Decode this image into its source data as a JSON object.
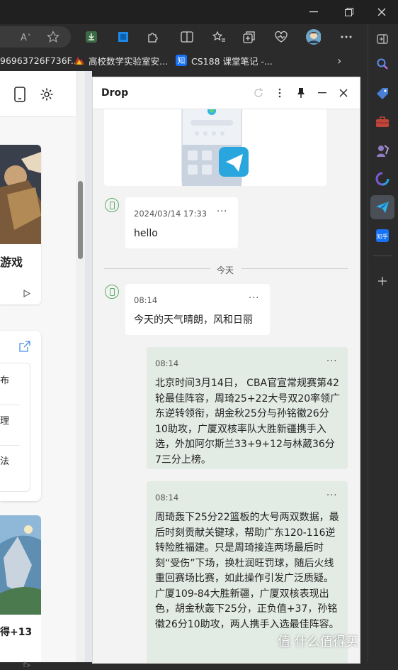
{
  "browser": {
    "favorites": [
      "96963726F736F...",
      "高校数学实验室安...",
      "CS188 课堂笔记 -..."
    ],
    "fav_icon_zhihu": "知"
  },
  "page": {
    "game_label": "游戏",
    "list_items": [
      "布",
      "理",
      "法"
    ],
    "counter_text": "得+13"
  },
  "drop": {
    "title": "Drop",
    "date_divider": "今天",
    "messages_in": [
      {
        "time": "2024/03/14 17:33",
        "text": "hello"
      },
      {
        "time": "08:14",
        "text": "今天的天气晴朗，风和日丽"
      }
    ],
    "messages_out": [
      {
        "time": "08:14",
        "text": "北京时间3月14日， CBA官宣常规赛第42轮最佳阵容，周琦25+22大号双20率领广东逆转领衔，胡金秋25分与孙铭徽26分10助攻，广厦双核率队大胜新疆携手入选，外加阿尔斯兰33+9+12与林葳36分7三分上榜。"
      },
      {
        "time": "08:14",
        "text": "周琦轰下25分22篮板的大号两双数据，最后时刻贡献关键球，帮助广东120-116逆转险胜福建。只是周琦接连两场最后时刻“受伤”下场，换杜润旺罚球，随后火线重回赛场比赛，如此操作引发广泛质疑。\n广厦109-84大胜新疆，广厦双核表现出色，胡金秋轰下25分，正负值+37，孙铭徽26分10助攻，两人携手入选最佳阵容。"
      }
    ],
    "more_glyph": "···"
  },
  "watermark": "值 什么值得买",
  "colors": {
    "accent_blue": "#1a73e8",
    "msg_out_bg": "#e3ebe5",
    "phone_green": "#5cae6b"
  }
}
